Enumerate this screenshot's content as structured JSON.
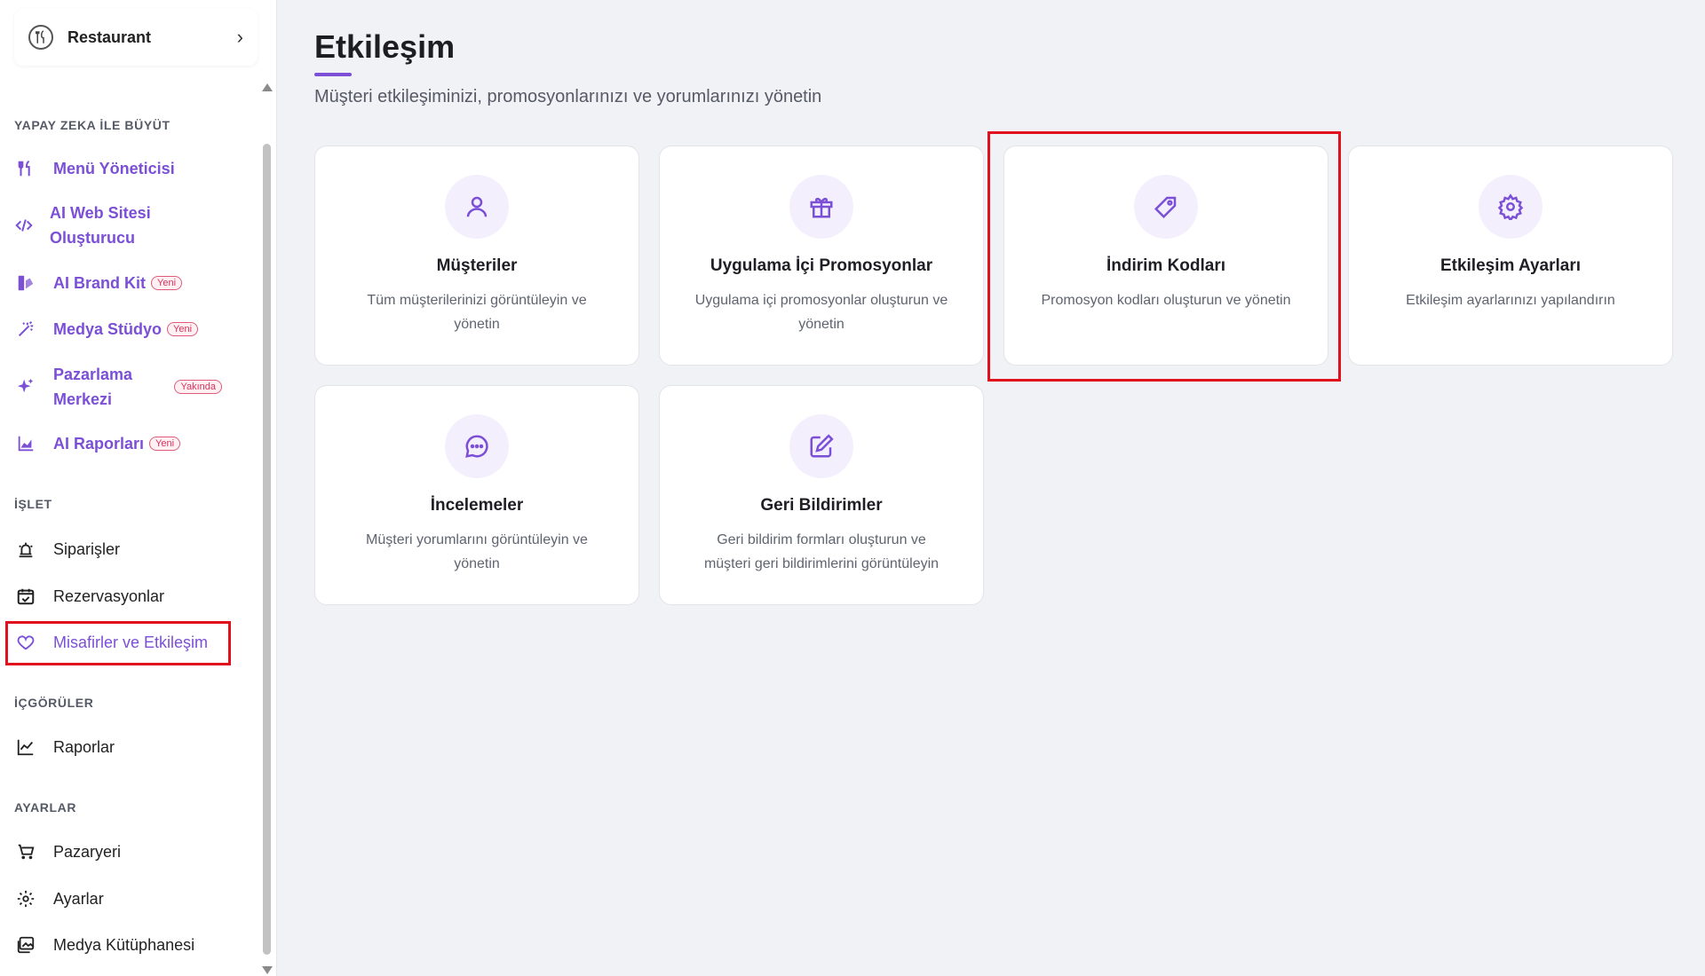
{
  "sidebar": {
    "restaurant_label": "Restaurant",
    "sections": {
      "ai": "YAPAY ZEKA İLE BÜYÜT",
      "operate": "İŞLET",
      "insights": "İÇGÖRÜLER",
      "settings": "AYARLAR"
    },
    "items": [
      {
        "label": "Menü Yöneticisi",
        "icon": "fork-knife-icon"
      },
      {
        "label": "AI Web Sitesi Oluşturucu",
        "icon": "code-icon"
      },
      {
        "label": "AI Brand Kit",
        "icon": "palette-icon",
        "badge": "Yeni"
      },
      {
        "label": "Medya Stüdyo",
        "icon": "magic-wand-icon",
        "badge": "Yeni"
      },
      {
        "label": "Pazarlama Merkezi",
        "icon": "sparkles-icon",
        "badge": "Yakında"
      },
      {
        "label": "AI Raporları",
        "icon": "area-chart-icon",
        "badge": "Yeni"
      },
      {
        "label": "Siparişler",
        "icon": "bell-icon"
      },
      {
        "label": "Rezervasyonlar",
        "icon": "calendar-check-icon"
      },
      {
        "label": "Misafirler ve Etkileşim",
        "icon": "heart-icon",
        "active": true
      },
      {
        "label": "Raporlar",
        "icon": "line-chart-icon"
      },
      {
        "label": "Pazaryeri",
        "icon": "cart-icon"
      },
      {
        "label": "Ayarlar",
        "icon": "gear-icon"
      },
      {
        "label": "Medya Kütüphanesi",
        "icon": "images-icon"
      }
    ]
  },
  "main": {
    "title": "Etkileşim",
    "subtitle": "Müşteri etkileşiminizi, promosyonlarınızı ve yorumlarınızı yönetin",
    "cards": [
      {
        "title": "Müşteriler",
        "desc": "Tüm müşterilerinizi görüntüleyin ve yönetin",
        "icon": "user-icon"
      },
      {
        "title": "Uygulama İçi Promosyonlar",
        "desc": "Uygulama içi promosyonlar oluşturun ve yönetin",
        "icon": "gift-icon"
      },
      {
        "title": "İndirim Kodları",
        "desc": "Promosyon kodları oluşturun ve yönetin",
        "icon": "tag-icon",
        "highlighted": true
      },
      {
        "title": "Etkileşim Ayarları",
        "desc": "Etkileşim ayarlarınızı yapılandırın",
        "icon": "gear-icon"
      },
      {
        "title": "İncelemeler",
        "desc": "Müşteri yorumlarını görüntüleyin ve yönetin",
        "icon": "chat-icon"
      },
      {
        "title": "Geri Bildirimler",
        "desc": "Geri bildirim formları oluşturun ve müşteri geri bildirimlerini görüntüleyin",
        "icon": "edit-icon"
      }
    ]
  },
  "colors": {
    "accent": "#7b4fd6",
    "highlight": "#e0101c",
    "icon_bg": "#f4effd"
  }
}
